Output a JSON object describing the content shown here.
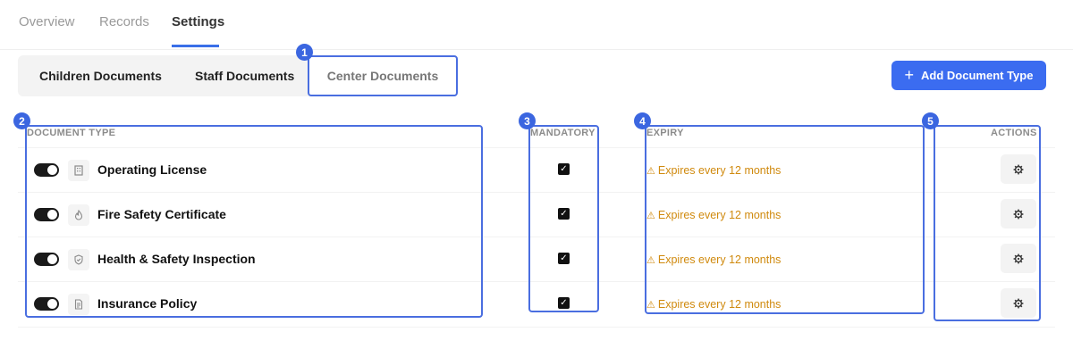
{
  "nav": {
    "tabs": [
      {
        "label": "Overview"
      },
      {
        "label": "Records"
      },
      {
        "label": "Settings",
        "active": true
      }
    ]
  },
  "subtabs": [
    {
      "label": "Children Documents"
    },
    {
      "label": "Staff Documents"
    },
    {
      "label": "Center Documents",
      "active": true
    }
  ],
  "add_button": {
    "label": "Add Document Type",
    "icon": "plus-icon"
  },
  "table": {
    "headers": {
      "document_type": "DOCUMENT TYPE",
      "mandatory": "MANDATORY",
      "expiry": "EXPIRY",
      "actions": "ACTIONS"
    },
    "rows": [
      {
        "name": "Operating License",
        "icon": "building-icon",
        "enabled": true,
        "mandatory": true,
        "expiry": "Expires every 12 months"
      },
      {
        "name": "Fire Safety Certificate",
        "icon": "flame-icon",
        "enabled": true,
        "mandatory": true,
        "expiry": "Expires every 12 months"
      },
      {
        "name": "Health & Safety Inspection",
        "icon": "shield-icon",
        "enabled": true,
        "mandatory": true,
        "expiry": "Expires every 12 months"
      },
      {
        "name": "Insurance Policy",
        "icon": "document-icon",
        "enabled": true,
        "mandatory": true,
        "expiry": "Expires every 12 months"
      }
    ]
  },
  "callouts": [
    "1",
    "2",
    "3",
    "4",
    "5"
  ],
  "colors": {
    "accent": "#3b6cf0",
    "callout": "#4a6ee0",
    "expiry_warning": "#d08a0e",
    "toggle_on": "#1a1a1a"
  }
}
